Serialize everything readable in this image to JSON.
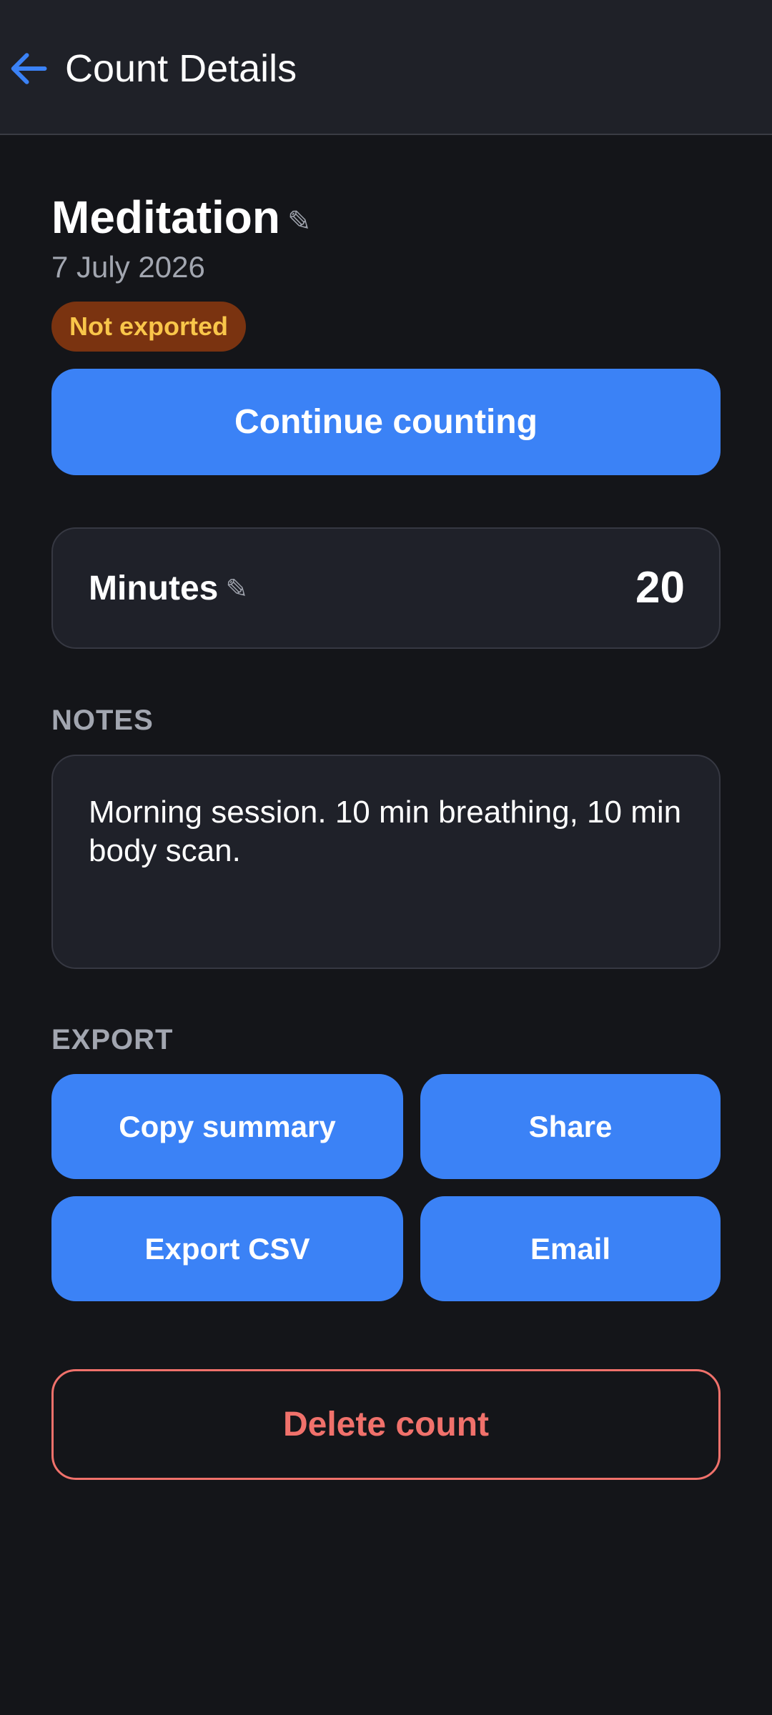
{
  "header": {
    "title": "Count Details",
    "back_icon": "arrow-left-icon"
  },
  "count": {
    "title": "Meditation",
    "edit_icon": "pencil-icon",
    "date": "7 July 2026",
    "status_badge": "Not exported",
    "continue_label": "Continue counting"
  },
  "minutes": {
    "label": "Minutes",
    "edit_icon": "pencil-icon",
    "value": "20"
  },
  "notes": {
    "section_label": "NOTES",
    "text": "Morning session. 10 min breathing, 10 min body scan."
  },
  "export": {
    "section_label": "EXPORT",
    "copy_summary_label": "Copy summary",
    "share_label": "Share",
    "export_csv_label": "Export CSV",
    "email_label": "Email"
  },
  "delete_label": "Delete count",
  "colors": {
    "background": "#141519",
    "topbar": "#1f2128",
    "accent": "#3b82f6",
    "badge_bg": "#7a3310",
    "badge_text": "#f9c64a",
    "danger": "#f0716b",
    "card": "#1f2129"
  }
}
